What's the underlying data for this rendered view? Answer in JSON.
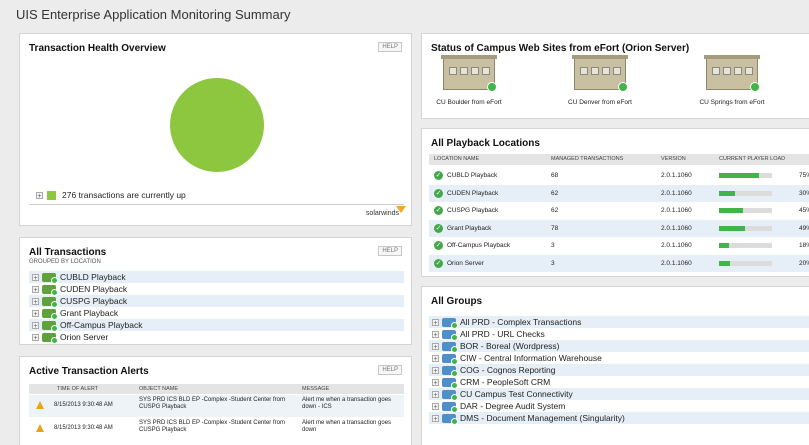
{
  "page_title": "UIS Enterprise Application Monitoring Summary",
  "help_label": "HELP",
  "health": {
    "title": "Transaction Health Overview",
    "up_text": "276 transactions are currently up",
    "logo": "solarwinds"
  },
  "all_transactions": {
    "title": "All Transactions",
    "subtitle": "GROUPED BY LOCATION",
    "items": [
      "CUBLD Playback",
      "CUDEN Playback",
      "CUSPG Playback",
      "Grant Playback",
      "Off-Campus Playback",
      "Orion Server"
    ]
  },
  "alerts": {
    "title": "Active Transaction Alerts",
    "columns": [
      "TIME OF ALERT",
      "OBJECT NAME",
      "MESSAGE"
    ],
    "rows": [
      {
        "time": "8/15/2013 9:30:48 AM",
        "object": "SYS PRD ICS BLD EP -Complex -Student Center from CUSPG Playback",
        "message": "Alert me when a transaction goes down - ICS"
      },
      {
        "time": "8/15/2013 9:30:48 AM",
        "object": "SYS PRD ICS BLD EP -Complex -Student Center from CUSPG Playback",
        "message": "Alert me when a transaction goes down"
      }
    ]
  },
  "campus": {
    "title": "Status of Campus Web Sites from eFort (Orion Server)",
    "sites": [
      "CU Boulder from eFort",
      "CU Denver from eFort",
      "CU Springs from eFort"
    ]
  },
  "playback": {
    "title": "All Playback Locations",
    "columns": [
      "LOCATION NAME",
      "MANAGED TRANSACTIONS",
      "VERSION",
      "CURRENT PLAYER LOAD"
    ],
    "rows": [
      {
        "name": "CUBLD Playback",
        "managed": "68",
        "version": "2.0.1.1060",
        "load_label": "75%",
        "load": 75
      },
      {
        "name": "CUDEN Playback",
        "managed": "62",
        "version": "2.0.1.1060",
        "load_label": "30%",
        "load": 30
      },
      {
        "name": "CUSPG Playback",
        "managed": "62",
        "version": "2.0.1.1060",
        "load_label": "45%",
        "load": 45
      },
      {
        "name": "Grant Playback",
        "managed": "78",
        "version": "2.0.1.1060",
        "load_label": "49%",
        "load": 49
      },
      {
        "name": "Off-Campus Playback",
        "managed": "3",
        "version": "2.0.1.1060",
        "load_label": "18%",
        "load": 18
      },
      {
        "name": "Orion Server",
        "managed": "3",
        "version": "2.0.1.1060",
        "load_label": "20%",
        "load": 20
      }
    ]
  },
  "all_groups": {
    "title": "All Groups",
    "items": [
      "All PRD - Complex Transactions",
      "All PRD - URL Checks",
      "BOR - Boreal (Wordpress)",
      "CIW - Central Information Warehouse",
      "COG - Cognos Reporting",
      "CRM - PeopleSoft CRM",
      "CU Campus Test Connectivity",
      "DAR - Degree Audit System",
      "DMS - Document Management (Singularity)"
    ]
  },
  "colors": {
    "up_green": "#8dc63f",
    "bar_green": "#3fb54a",
    "row_alt": "#e6eff7"
  }
}
